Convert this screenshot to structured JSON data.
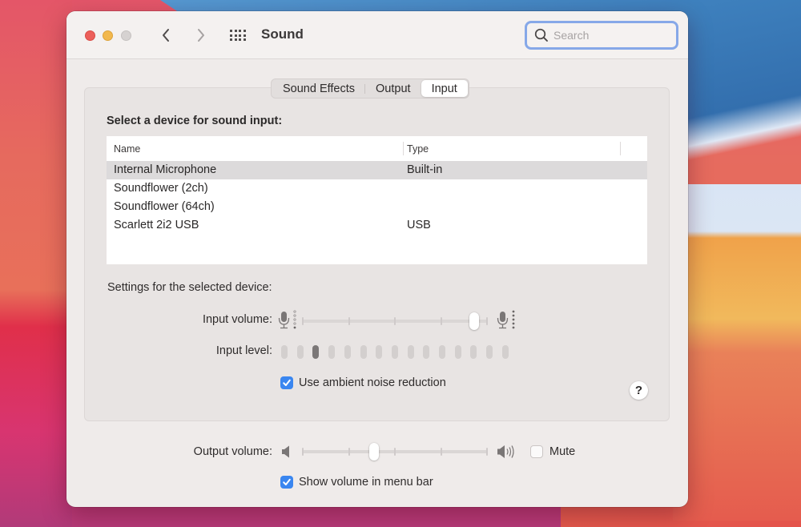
{
  "window": {
    "title": "Sound",
    "traffic_lights": [
      {
        "name": "close",
        "color": "#ec5f5a"
      },
      {
        "name": "minimize",
        "color": "#f2b84d"
      },
      {
        "name": "zoom",
        "color": "#d6d2d1"
      }
    ],
    "nav": {
      "back_icon": "chevron-left-icon",
      "forward_icon": "chevron-right-icon",
      "grid_icon": "show-all-grid-icon"
    },
    "search": {
      "placeholder": "Search",
      "value": "",
      "icon": "magnifier-icon"
    }
  },
  "tabs": [
    {
      "label": "Sound Effects",
      "active": false
    },
    {
      "label": "Output",
      "active": false
    },
    {
      "label": "Input",
      "active": true
    }
  ],
  "input_panel": {
    "heading": "Select a device for sound input:",
    "table": {
      "columns": [
        "Name",
        "Type"
      ],
      "rows": [
        {
          "name": "Internal Microphone",
          "type": "Built-in",
          "selected": true
        },
        {
          "name": "Soundflower (2ch)",
          "type": "",
          "selected": false
        },
        {
          "name": "Soundflower (64ch)",
          "type": "",
          "selected": false
        },
        {
          "name": "Scarlett 2i2 USB",
          "type": "USB",
          "selected": false
        }
      ]
    },
    "settings_label": "Settings for the selected device:",
    "input_volume": {
      "label": "Input volume:",
      "value_percent": 95,
      "low_icon": "microphone-low-icon",
      "high_icon": "microphone-high-icon"
    },
    "input_level": {
      "label": "Input level:",
      "segments": 15,
      "active_segment": 3
    },
    "noise_reduction": {
      "label": "Use ambient noise reduction",
      "checked": true
    },
    "help_label": "?"
  },
  "output": {
    "volume": {
      "label": "Output volume:",
      "value_percent": 38,
      "low_icon": "speaker-low-icon",
      "high_icon": "speaker-high-icon"
    },
    "mute": {
      "label": "Mute",
      "checked": false
    },
    "show_in_menu_bar": {
      "label": "Show volume in menu bar",
      "checked": true
    }
  },
  "colors": {
    "accent": "#3a86f0",
    "search_focus_ring": "#86a8e8",
    "selected_row": "#dcdadb"
  }
}
